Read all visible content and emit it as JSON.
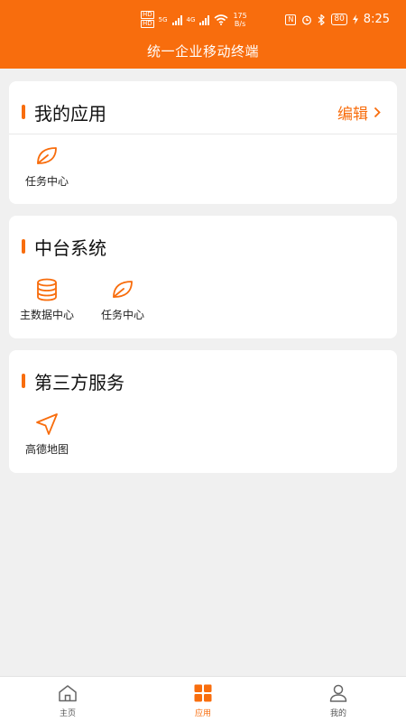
{
  "status_bar": {
    "hd1": "HD",
    "hd2": "HD",
    "net1": "5G",
    "net2": "4G",
    "speed_value": "175",
    "speed_unit": "B/s",
    "nfc": "N",
    "battery": "80",
    "time": "8:25"
  },
  "header": {
    "title": "统一企业移动终端"
  },
  "my_apps": {
    "title": "我的应用",
    "edit_label": "编辑",
    "items": [
      {
        "label": "任务中心",
        "icon": "leaf-icon"
      }
    ]
  },
  "middle_platform": {
    "title": "中台系统",
    "items": [
      {
        "label": "主数据中心",
        "icon": "database-icon"
      },
      {
        "label": "任务中心",
        "icon": "leaf-icon"
      }
    ]
  },
  "third_party": {
    "title": "第三方服务",
    "items": [
      {
        "label": "高德地图",
        "icon": "navigation-icon"
      }
    ]
  },
  "bottom_nav": {
    "items": [
      {
        "label": "主页",
        "icon": "home-icon"
      },
      {
        "label": "应用",
        "icon": "grid-icon",
        "active": true
      },
      {
        "label": "我的",
        "icon": "user-icon"
      }
    ]
  },
  "colors": {
    "accent": "#f86d0d",
    "background": "#f0f0f0",
    "card": "#ffffff"
  }
}
